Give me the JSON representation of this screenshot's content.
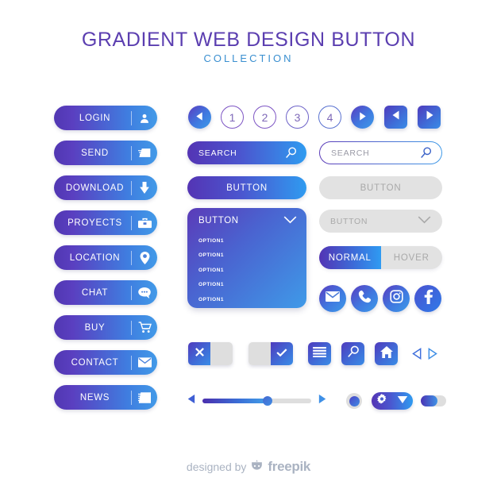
{
  "header": {
    "title": "GRADIENT WEB DESIGN BUTTON",
    "subtitle": "COLLECTION"
  },
  "colors": {
    "gradient_start": "#5137b2",
    "gradient_end": "#429ae8",
    "purple": "#5b3eb0",
    "blue": "#3a8fd0",
    "muted_gray": "#dedede",
    "muted_text": "#a9a9a9",
    "footer_text": "#aab3c2"
  },
  "left_buttons": [
    {
      "label": "LOGIN",
      "icon": "user-icon"
    },
    {
      "label": "SEND",
      "icon": "send-envelope-icon"
    },
    {
      "label": "DOWNLOAD",
      "icon": "download-arrow-icon"
    },
    {
      "label": "PROYECTS",
      "icon": "toolbox-icon"
    },
    {
      "label": "LOCATION",
      "icon": "map-pin-icon"
    },
    {
      "label": "CHAT",
      "icon": "chat-bubble-icon"
    },
    {
      "label": "BUY",
      "icon": "shopping-cart-icon"
    },
    {
      "label": "CONTACT",
      "icon": "envelope-icon"
    },
    {
      "label": "NEWS",
      "icon": "news-lines-icon"
    }
  ],
  "pagination": {
    "prev_icon": "triangle-left-icon",
    "next_icon": "triangle-right-icon",
    "pages": [
      "1",
      "2",
      "3",
      "4"
    ],
    "square_prev_icon": "triangle-left-icon",
    "square_next_icon": "triangle-right-icon"
  },
  "search": {
    "filled_label": "SEARCH",
    "outline_placeholder": "SEARCH",
    "icon": "magnifier-icon"
  },
  "buttons": {
    "primary_label": "BUTTON",
    "disabled_label": "BUTTON"
  },
  "dropdown": {
    "header_label": "BUTTON",
    "chevron_icon": "chevron-down-icon",
    "options": [
      "OPTION1",
      "OPTION1",
      "OPTION1",
      "OPTION1",
      "OPTION1"
    ]
  },
  "select_muted": {
    "label": "BUTTON",
    "chevron_icon": "chevron-down-icon"
  },
  "segmented": {
    "active_label": "NORMAL",
    "inactive_label": "HOVER"
  },
  "social": [
    {
      "name": "email",
      "icon": "envelope-icon"
    },
    {
      "name": "phone",
      "icon": "phone-icon"
    },
    {
      "name": "instagram",
      "icon": "instagram-icon"
    },
    {
      "name": "facebook",
      "icon": "facebook-icon"
    }
  ],
  "toggles": {
    "close_icon": "x-icon",
    "check_icon": "check-icon"
  },
  "icon_squares": [
    {
      "name": "menu",
      "icon": "hamburger-menu-icon"
    },
    {
      "name": "search",
      "icon": "magnifier-icon"
    },
    {
      "name": "home",
      "icon": "home-icon"
    }
  ],
  "small_arrows": {
    "left_icon": "triangle-left-outline-icon",
    "right_icon": "triangle-right-outline-icon"
  },
  "slider": {
    "value_percent": 60,
    "left_icon": "triangle-left-icon",
    "right_icon": "triangle-right-icon"
  },
  "gear_pill": {
    "gear_icon": "gear-icon",
    "chevron_icon": "chevron-down-filled-icon"
  },
  "footer": {
    "prefix": "designed by",
    "brand": "freepik",
    "logo_icon": "freepik-logo-icon"
  }
}
